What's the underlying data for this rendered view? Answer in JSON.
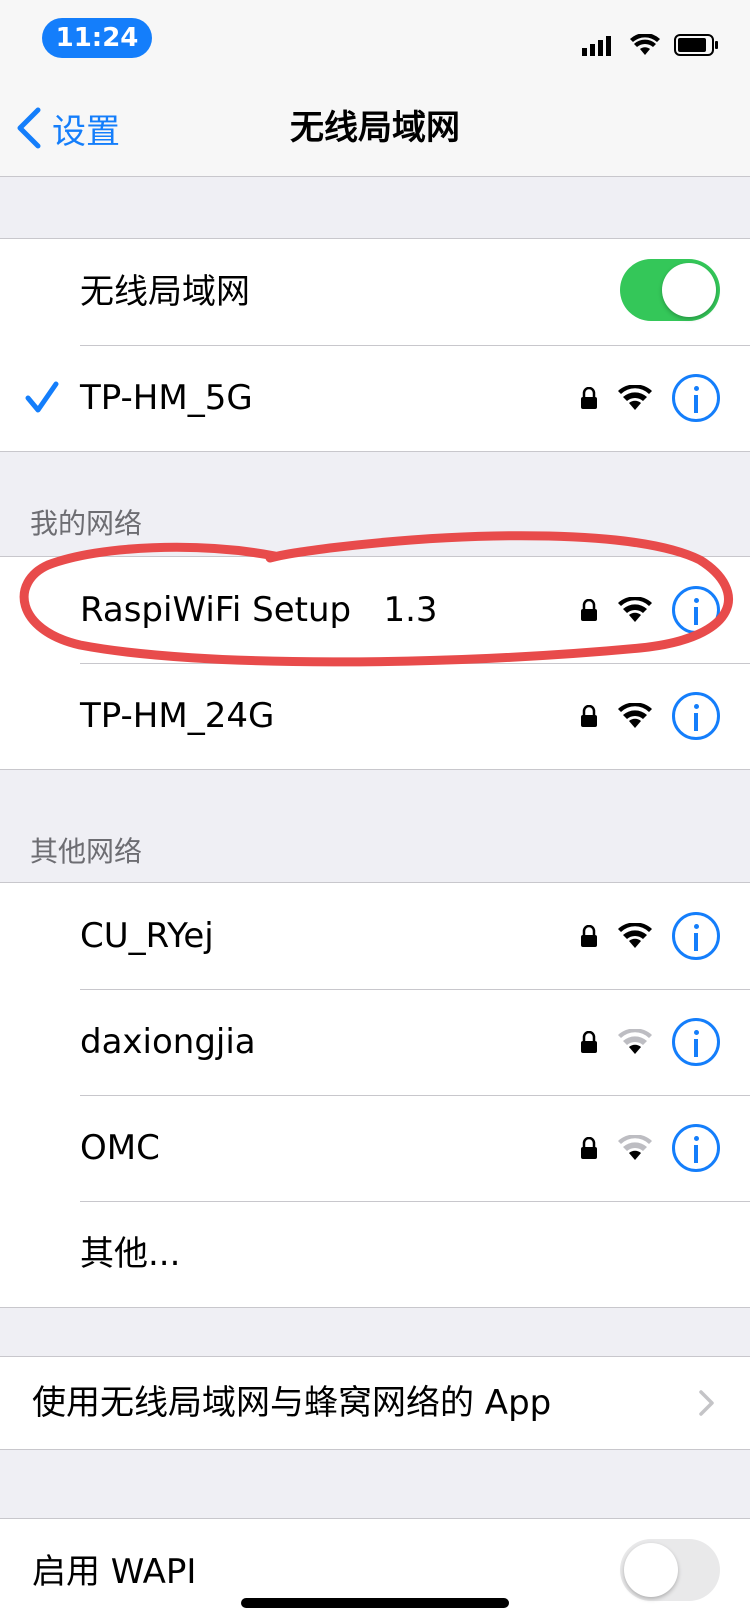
{
  "status": {
    "time": "11:24"
  },
  "nav": {
    "back_label": "设置",
    "title": "无线局域网"
  },
  "wifi_toggle": {
    "label": "无线局域网",
    "on": true
  },
  "connected_network": {
    "name": "TP-HM_5G"
  },
  "sections": {
    "my_networks": "我的网络",
    "other_networks": "其他网络"
  },
  "my_networks": [
    {
      "name": "RaspiWiFi Setup   1.3",
      "signal": 3
    },
    {
      "name": "TP-HM_24G",
      "signal": 3
    }
  ],
  "other_networks": [
    {
      "name": "CU_RYej",
      "signal": 3
    },
    {
      "name": "daxiongjia",
      "signal": 1
    },
    {
      "name": "OMC",
      "signal": 1
    }
  ],
  "other_label": "其他...",
  "apps_row": {
    "label": "使用无线局域网与蜂窝网络的 App"
  },
  "wapi_row": {
    "label": "启用 WAPI",
    "on": false
  },
  "colors": {
    "accent": "#147efb",
    "toggle_on": "#34c759",
    "annotation": "#e84b4b",
    "background": "#efeff4"
  },
  "icons": {
    "back": "chevron-left-icon",
    "check": "checkmark-icon",
    "lock": "lock-icon",
    "wifi": "wifi-icon",
    "info": "info-icon",
    "chevron": "chevron-right-icon"
  }
}
